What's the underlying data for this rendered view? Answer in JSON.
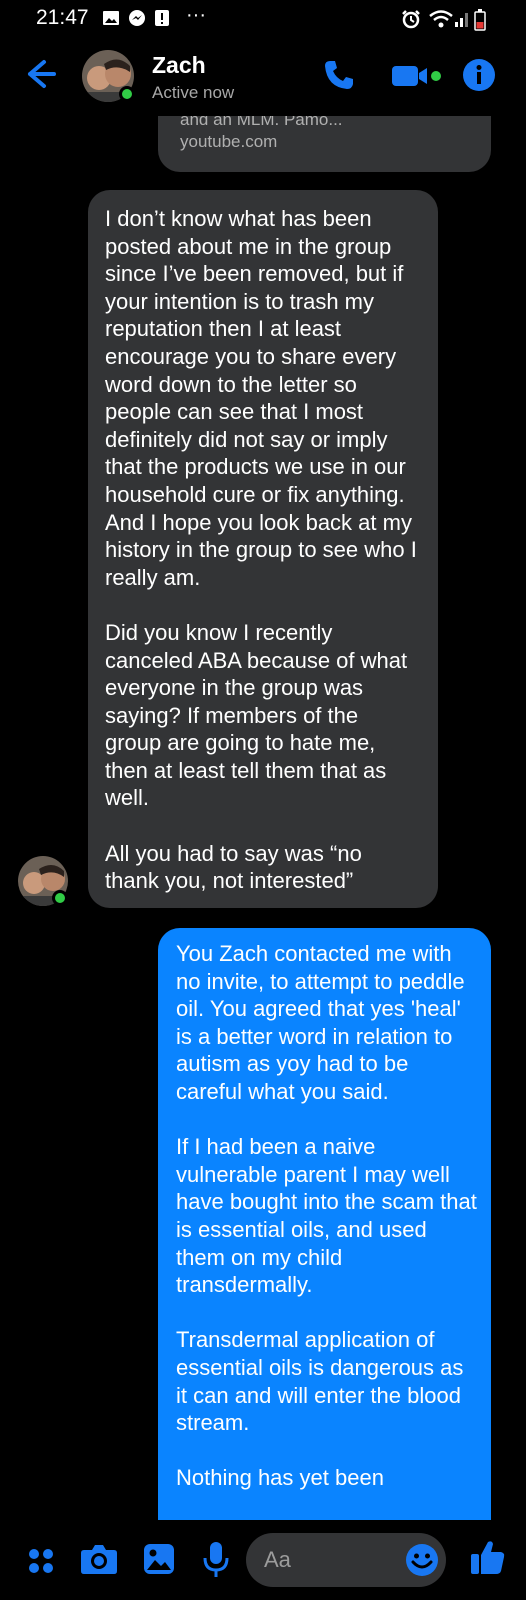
{
  "status_bar": {
    "time": "21:47",
    "left_icons": [
      "image-icon",
      "messenger-icon",
      "alert-icon",
      "more-dots-icon"
    ],
    "right_icons": [
      "alarm-icon",
      "wifi-icon",
      "signal-icon",
      "battery-icon"
    ],
    "ellipsis": "···"
  },
  "header": {
    "contact_name": "Zach",
    "contact_status": "Active now",
    "accent_color": "#1877f2",
    "online_color": "#31cc46"
  },
  "messages": {
    "link_card": {
      "snippet": "and an MLM. Pamo...",
      "domain": "youtube.com"
    },
    "incoming_1": {
      "text": "I don’t know what has been posted about me in the group since I’ve been removed, but if your intention is to trash my reputation then I at least encourage you to share every word down to the letter so people can see that I most definitely did not say or imply that the products we use in our household cure or fix anything. And I hope you look back at my history in the group to see who I really am.\n\nDid you know I recently canceled ABA because of what everyone in the group was saying?  If members of the group are going to hate me, then at least tell them that as well.\n\nAll you had to say was “no thank you, not interested”"
    },
    "outgoing_1": {
      "text": "You Zach contacted me with no invite, to attempt to peddle oil. You agreed that yes 'heal' is a better word in relation to autism as yoy had to be careful what you said.\n\nIf I had been a naive vulnerable parent I may well have bought into the scam that is essential oils, and used them on my child transdermally.\n\nTransdermal application of essential oils is dangerous as it can and will enter the blood stream.\n\nNothing has yet been"
    }
  },
  "composer": {
    "placeholder": "Aa",
    "icons": [
      "menu-dots-icon",
      "camera-icon",
      "gallery-icon",
      "microphone-icon",
      "emoji-icon",
      "thumbs-up-icon"
    ]
  }
}
